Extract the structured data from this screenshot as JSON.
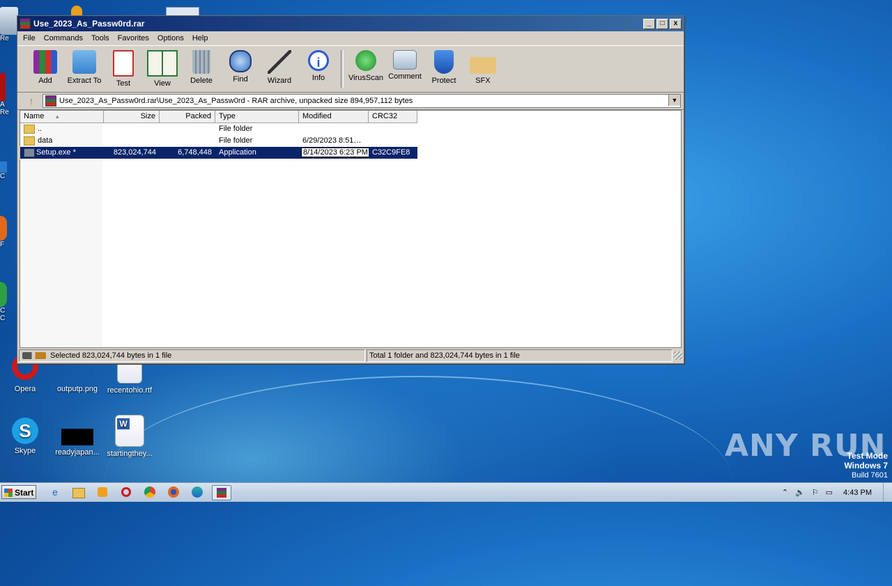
{
  "window": {
    "title": "Use_2023_As_Passw0rd.rar",
    "controls": {
      "minimize": "_",
      "maximize": "□",
      "close": "x"
    }
  },
  "menu": [
    "File",
    "Commands",
    "Tools",
    "Favorites",
    "Options",
    "Help"
  ],
  "toolbar": [
    {
      "label": "Add",
      "icon": "add-icon"
    },
    {
      "label": "Extract To",
      "icon": "extract-to-icon"
    },
    {
      "label": "Test",
      "icon": "test-icon"
    },
    {
      "label": "View",
      "icon": "view-icon"
    },
    {
      "label": "Delete",
      "icon": "delete-icon"
    },
    {
      "label": "Find",
      "icon": "find-icon"
    },
    {
      "label": "Wizard",
      "icon": "wizard-icon"
    },
    {
      "label": "Info",
      "icon": "info-icon"
    },
    {
      "label": "VirusScan",
      "icon": "virusscan-icon"
    },
    {
      "label": "Comment",
      "icon": "comment-icon"
    },
    {
      "label": "Protect",
      "icon": "protect-icon"
    },
    {
      "label": "SFX",
      "icon": "sfx-icon"
    }
  ],
  "address": {
    "path": "Use_2023_As_Passw0rd.rar\\Use_2023_As_Passw0rd - RAR archive, unpacked size 894,957,112 bytes"
  },
  "columns": [
    "Name",
    "Size",
    "Packed",
    "Type",
    "Modified",
    "CRC32"
  ],
  "rows": [
    {
      "name": "..",
      "size": "",
      "packed": "",
      "type": "File folder",
      "modified": "",
      "crc": ""
    },
    {
      "name": "data",
      "size": "",
      "packed": "",
      "type": "File folder",
      "modified": "6/29/2023 8:51…",
      "crc": ""
    },
    {
      "name": "Setup.exe *",
      "size": "823,024,744",
      "packed": "6,748,448",
      "type": "Application",
      "modified": "8/14/2023 6:23 PM",
      "crc": "C32C9FE8"
    }
  ],
  "status": {
    "left": "Selected 823,024,744 bytes in 1 file",
    "right": "Total 1 folder and 823,024,744 bytes in 1 file"
  },
  "desktop": {
    "icons": [
      {
        "label": "Opera"
      },
      {
        "label": "outputp.png"
      },
      {
        "label": "recentohio.rtf"
      },
      {
        "label": "Skype"
      },
      {
        "label": "readyjapan..."
      },
      {
        "label": "startingthey..."
      }
    ],
    "left_stubs": [
      "Re",
      "A",
      "Re",
      "C",
      "F",
      "C",
      "C"
    ]
  },
  "taskbar": {
    "start_label": "Start",
    "clock": "4:43 PM"
  },
  "watermark": {
    "brand": "ANY RUN",
    "line1": "Test Mode",
    "line2": "Windows 7",
    "line3": "Build 7601"
  }
}
